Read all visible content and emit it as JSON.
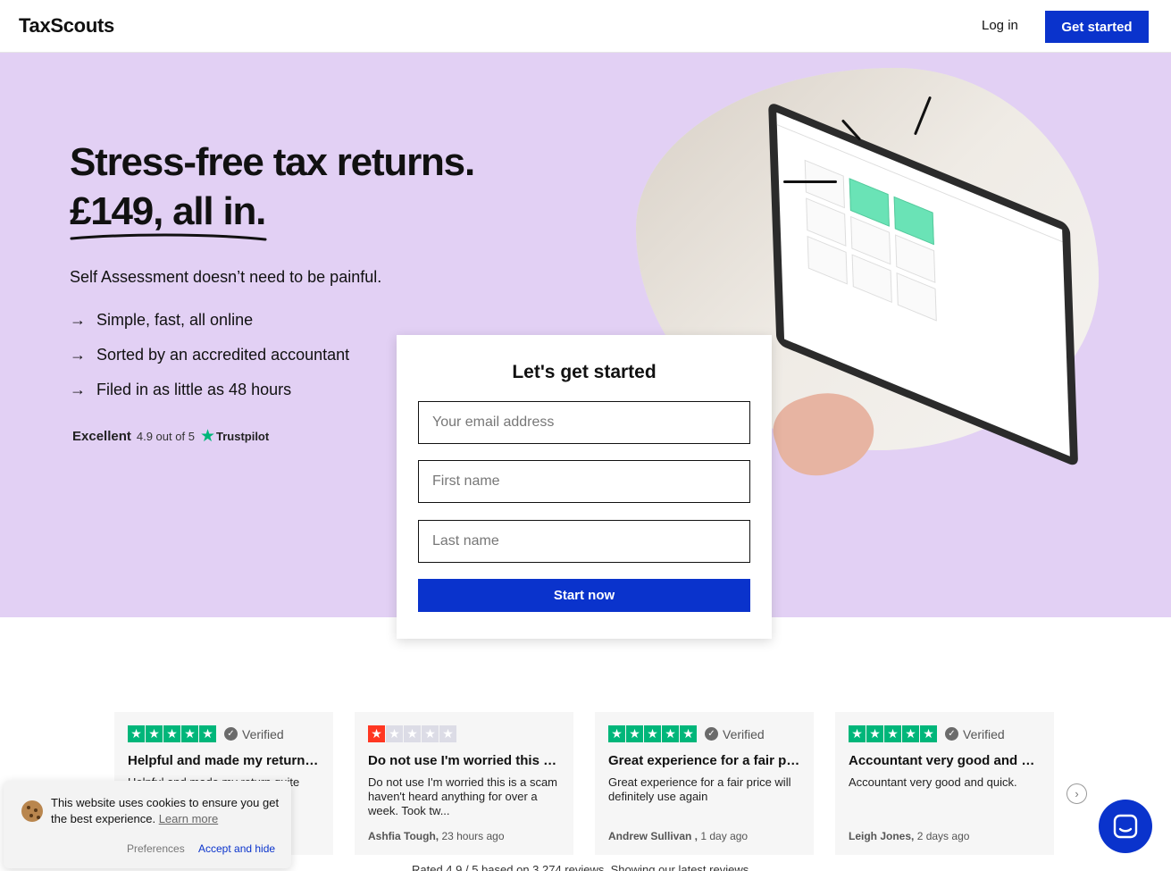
{
  "header": {
    "logo": "TaxScouts",
    "login_label": "Log in",
    "get_started_label": "Get started"
  },
  "hero": {
    "headline_line1": "Stress-free tax returns.",
    "headline_line2": "£149, all in.",
    "subtitle": "Self Assessment doesn’t need to be painful.",
    "bullets": [
      "Simple, fast, all online",
      "Sorted by an accredited accountant",
      "Filed in as little as 48 hours"
    ],
    "trustpilot": {
      "rating_word": "Excellent",
      "score_text": "4.9 out of 5",
      "brand": "Trustpilot"
    }
  },
  "signup": {
    "title": "Let's get started",
    "email_placeholder": "Your email address",
    "first_name_placeholder": "First name",
    "last_name_placeholder": "Last name",
    "submit_label": "Start now"
  },
  "reviews": {
    "items": [
      {
        "stars": 5,
        "verified": "Verified",
        "title": "Helpful and made my return q...",
        "body": "Helpful and made my return quite",
        "author": "",
        "when": ""
      },
      {
        "stars": 1,
        "verified": "",
        "title": "Do not use I'm worried this is ...",
        "body": "Do not use I'm worried this is a scam haven't heard anything for over a week. Took tw...",
        "author": "Ashfia Tough,",
        "when": "23 hours ago"
      },
      {
        "stars": 5,
        "verified": "Verified",
        "title": "Great experience for a fair pri...",
        "body": "Great experience for a fair price will definitely use again",
        "author": "Andrew Sullivan ,",
        "when": "1 day ago"
      },
      {
        "stars": 5,
        "verified": "Verified",
        "title": "Accountant very good and qui...",
        "body": "Accountant very good and quick.",
        "author": "Leigh Jones,",
        "when": "2 days ago"
      }
    ],
    "rated_text": "Rated 4.9 / 5 based on 3,274 reviews. Showing our latest reviews."
  },
  "cookie": {
    "message": "This website uses cookies to ensure you get the best experience.",
    "learn_more": "Learn more",
    "preferences": "Preferences",
    "accept": "Accept and hide"
  },
  "colors": {
    "brand_blue": "#0a33cc",
    "hero_lavender": "#e2d0f4",
    "trustpilot_green": "#00b67a",
    "one_star_red": "#ff3722"
  },
  "icons": [
    "arrow-right-icon",
    "trustpilot-star-icon",
    "verified-check-icon",
    "chevron-right-icon",
    "cookie-icon",
    "chat-icon"
  ]
}
